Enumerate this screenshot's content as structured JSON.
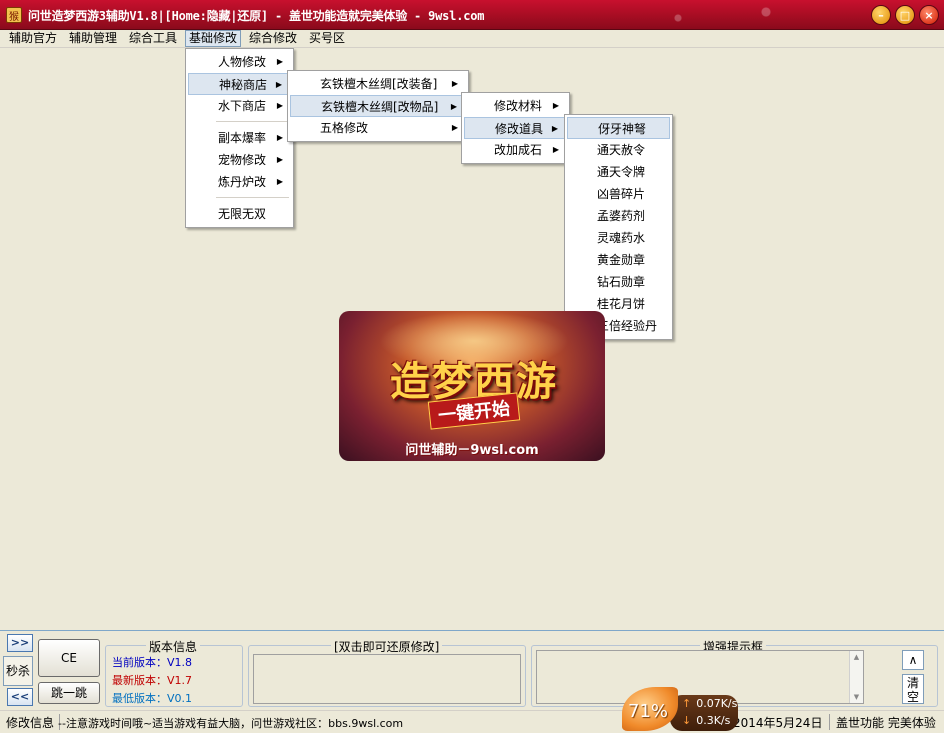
{
  "window": {
    "title": "问世造梦西游3辅助V1.8|[Home:隐藏|还原] - 盖世功能造就完美体验 - 9wsl.com",
    "icon": "app-icon",
    "controls": {
      "minimize": "minimize-icon",
      "maximize": "maximize-icon",
      "close": "close-icon"
    }
  },
  "menubar": {
    "items": [
      {
        "label": "辅助官方"
      },
      {
        "label": "辅助管理"
      },
      {
        "label": "综合工具"
      },
      {
        "label": "基础修改",
        "active": true
      },
      {
        "label": "综合修改"
      },
      {
        "label": "买号区"
      }
    ]
  },
  "menu_basic": {
    "items": [
      {
        "label": "人物修改",
        "submenu": true
      },
      {
        "label": "神秘商店",
        "submenu": true,
        "highlighted": true
      },
      {
        "label": "水下商店",
        "submenu": true
      },
      {
        "label": "副本爆率",
        "submenu": true
      },
      {
        "label": "宠物修改",
        "submenu": true
      },
      {
        "label": "炼丹炉改",
        "submenu": true
      },
      {
        "label": "无限无双",
        "submenu": false
      }
    ]
  },
  "menu_shop": {
    "items": [
      {
        "label": "玄铁檀木丝绸[改装备]",
        "submenu": true
      },
      {
        "label": "玄铁檀木丝绸[改物品]",
        "submenu": true,
        "highlighted": true
      },
      {
        "label": "五格修改",
        "submenu": true
      }
    ]
  },
  "menu_items": {
    "items": [
      {
        "label": "修改材料",
        "submenu": true
      },
      {
        "label": "修改道具",
        "submenu": true,
        "highlighted": true
      },
      {
        "label": "改加成石",
        "submenu": true
      }
    ]
  },
  "menu_props": {
    "items": [
      {
        "label": "伢牙神弩",
        "highlighted": true
      },
      {
        "label": "通天赦令"
      },
      {
        "label": "通天令牌"
      },
      {
        "label": "凶兽碎片"
      },
      {
        "label": "孟婆药剂"
      },
      {
        "label": "灵魂药水"
      },
      {
        "label": "黄金勋章"
      },
      {
        "label": "钻石勋章"
      },
      {
        "label": "桂花月饼"
      },
      {
        "label": "三倍经验丹"
      }
    ]
  },
  "banner": {
    "title": "造梦西游",
    "subtitle": "一键开始",
    "footer": "问世辅助－9wsl.com"
  },
  "bottom_panel": {
    "nav_forward": ">>",
    "nav_back": "<<",
    "miaosha": "秒杀",
    "ce_button": "CE",
    "jump_button": "跳一跳",
    "version": {
      "title": "版本信息",
      "current": "当前版本：V1.8",
      "latest": "最新版本：V1.7",
      "lowest": "最低版本：V0.1"
    },
    "restore_title": "[双击即可还原修改]",
    "hint_title": "增强提示框",
    "up_button": "∧",
    "clear_button": "清空"
  },
  "statusbar": {
    "label": "修改信息",
    "message": "--注意游戏时间哦~适当游戏有益大脑，问世游戏社区：bbs.9wsl.com",
    "date": "2014年5月24日",
    "right": "盖世功能 完美体验"
  },
  "speed_widget": {
    "percent": "71%",
    "upload": "0.07K/s",
    "download": "0.3K/s"
  },
  "colors": {
    "titlebar": "#b5102a",
    "menu_highlight": "#dde6f0",
    "version_current": "#0000c0",
    "version_latest": "#c00000",
    "version_lowest": "#0070c0"
  }
}
